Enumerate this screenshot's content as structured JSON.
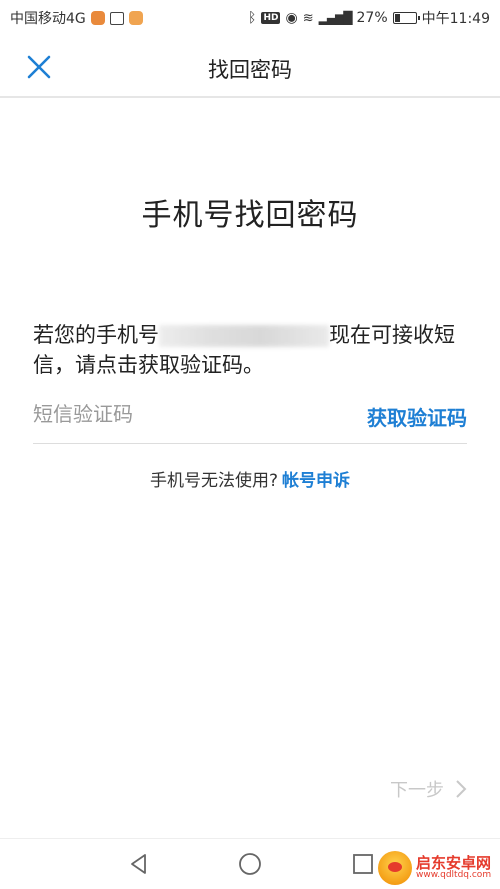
{
  "status_bar": {
    "carrier": "中国移动4G",
    "signal_label": "4G",
    "battery": "27%",
    "battery_level": 0.27,
    "time": "中午11:49"
  },
  "nav": {
    "title": "找回密码",
    "close_icon": "close-icon"
  },
  "page": {
    "heading": "手机号找回密码",
    "desc_prefix": "若您的手机号",
    "desc_suffix": "现在可接收短信，请点击获取验证码。",
    "code_placeholder": "短信验证码",
    "get_code_label": "获取验证码",
    "help_text": "手机号无法使用?",
    "appeal_label": "帐号申诉",
    "next_label": "下一步"
  },
  "watermark": {
    "name": "启东安卓网",
    "url": "www.qdltdq.com"
  },
  "colors": {
    "accent": "#1e7fd4",
    "disabled": "#c8c8c8"
  }
}
